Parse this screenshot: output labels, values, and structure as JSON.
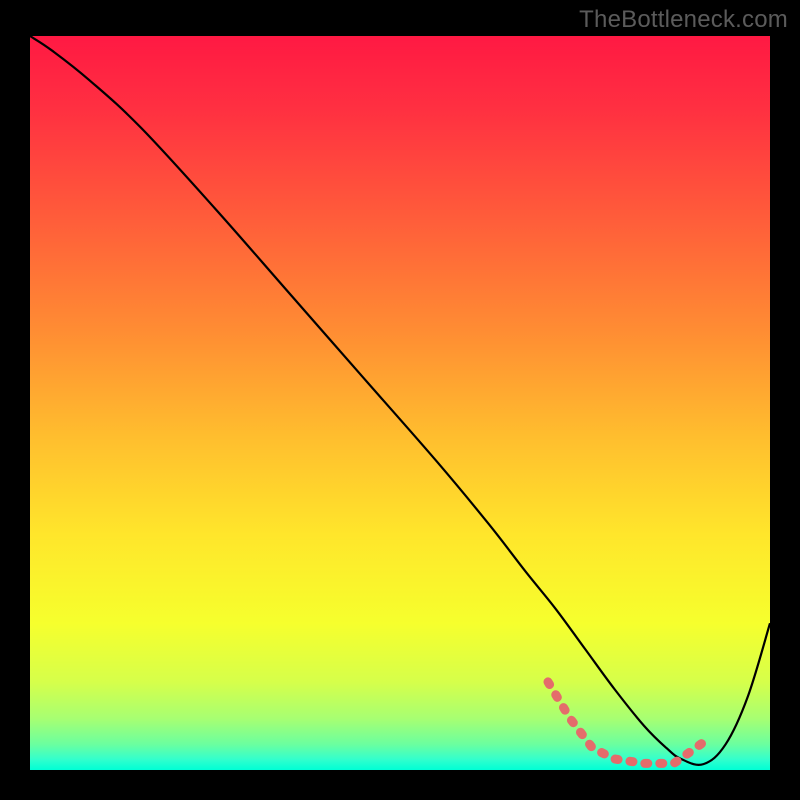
{
  "watermark": "TheBottleneck.com",
  "colors": {
    "black_border": "#000000",
    "curve": "#000000",
    "pink_segment": "#e46c6b",
    "gradient": [
      {
        "offset": 0.0,
        "color": "#ff1943"
      },
      {
        "offset": 0.1,
        "color": "#ff3041"
      },
      {
        "offset": 0.25,
        "color": "#ff5d3a"
      },
      {
        "offset": 0.4,
        "color": "#ff8c33"
      },
      {
        "offset": 0.55,
        "color": "#ffbf2e"
      },
      {
        "offset": 0.68,
        "color": "#ffe62b"
      },
      {
        "offset": 0.8,
        "color": "#f6ff2d"
      },
      {
        "offset": 0.88,
        "color": "#d6ff4a"
      },
      {
        "offset": 0.93,
        "color": "#a7ff72"
      },
      {
        "offset": 0.965,
        "color": "#6bff9f"
      },
      {
        "offset": 0.985,
        "color": "#34ffcc"
      },
      {
        "offset": 1.0,
        "color": "#00ffd5"
      }
    ]
  },
  "chart_data": {
    "type": "line",
    "title": "",
    "xlabel": "",
    "ylabel": "",
    "xlim": [
      0,
      100
    ],
    "ylim": [
      0,
      100
    ],
    "grid": false,
    "legend": false,
    "series": [
      {
        "name": "curve",
        "x": [
          0,
          3,
          8,
          15,
          25,
          35,
          45,
          55,
          62,
          67,
          71,
          75,
          79,
          83,
          86,
          88,
          91,
          94,
          97,
          100
        ],
        "y": [
          100,
          98,
          94,
          87.5,
          76.5,
          65,
          53.5,
          42,
          33.5,
          27,
          22,
          16.5,
          11,
          6,
          3,
          1.5,
          0.8,
          3.5,
          10,
          20
        ]
      }
    ],
    "highlight": {
      "name": "pink-segment",
      "x_start": 70,
      "x_end": 92,
      "y_approx": 1.0
    }
  }
}
